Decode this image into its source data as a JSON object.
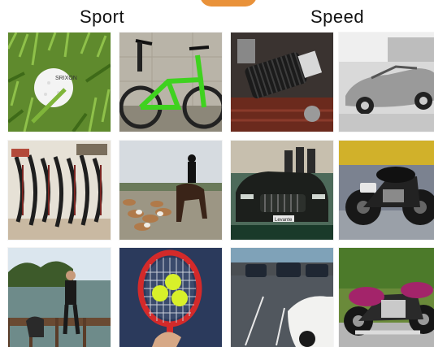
{
  "header": {
    "left_title": "Sport",
    "right_title": "Speed",
    "accent_color": "#e9923a"
  },
  "tiles": [
    {
      "name": "golf-ball-on-grass",
      "group": "Sport",
      "logo_text": "SRIXON"
    },
    {
      "name": "green-bicycle",
      "group": "Sport"
    },
    {
      "name": "engine-air-filter",
      "group": "Speed"
    },
    {
      "name": "silver-classic-convertible",
      "group": "Speed"
    },
    {
      "name": "archery-bows-rack",
      "group": "Sport"
    },
    {
      "name": "horse-rider-with-hounds",
      "group": "Sport"
    },
    {
      "name": "dark-suv-display",
      "group": "Speed",
      "plate_text": "Levante"
    },
    {
      "name": "black-motorcycle",
      "group": "Speed"
    },
    {
      "name": "runner-at-lake-with-dog",
      "group": "Sport"
    },
    {
      "name": "tennis-racket-with-balls",
      "group": "Sport"
    },
    {
      "name": "parked-cars-lot",
      "group": "Speed"
    },
    {
      "name": "magenta-cruiser-motorcycle",
      "group": "Speed"
    }
  ]
}
